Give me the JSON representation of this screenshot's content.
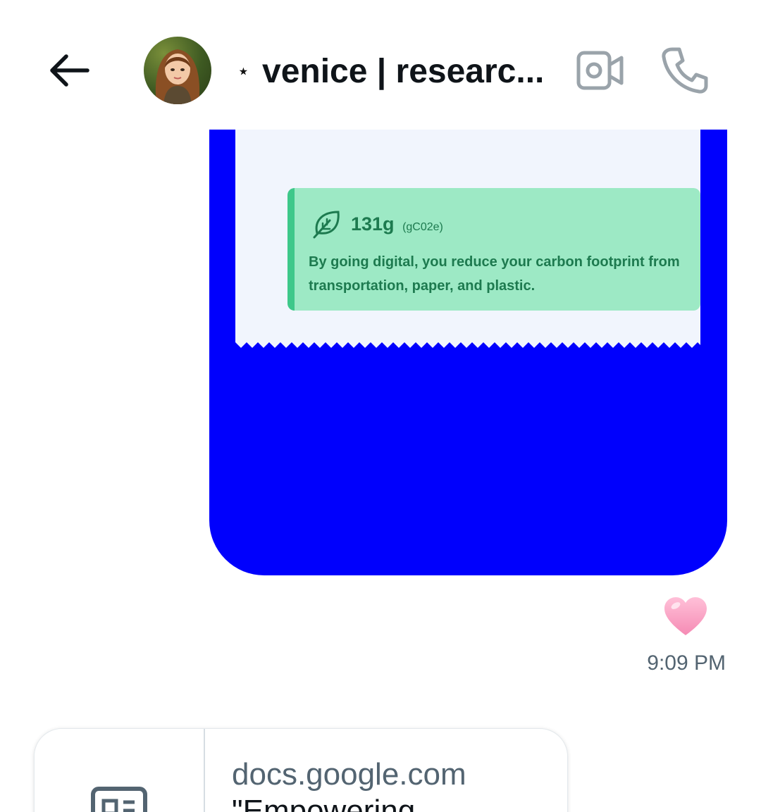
{
  "header": {
    "back_icon": "arrow-left-icon",
    "title_prefix": "⋆",
    "title": "venice | researc...",
    "video_icon": "video-camera-icon",
    "phone_icon": "phone-icon"
  },
  "message": {
    "receipt": {
      "amount": "131g",
      "unit": "(gC02e)",
      "description": "By going digital, you reduce your carbon footprint from transportation, paper, and plastic."
    },
    "reaction": "🩷",
    "time": "9:09 PM"
  },
  "link_card": {
    "domain": "docs.google.com",
    "title": "\"Empowering",
    "icon": "document-icon"
  },
  "colors": {
    "bubble": "#0000fd",
    "receipt_bg": "#f1f5fd",
    "eco_card": "#9de9c5",
    "eco_text": "#1d7a4f",
    "muted": "#536471"
  }
}
